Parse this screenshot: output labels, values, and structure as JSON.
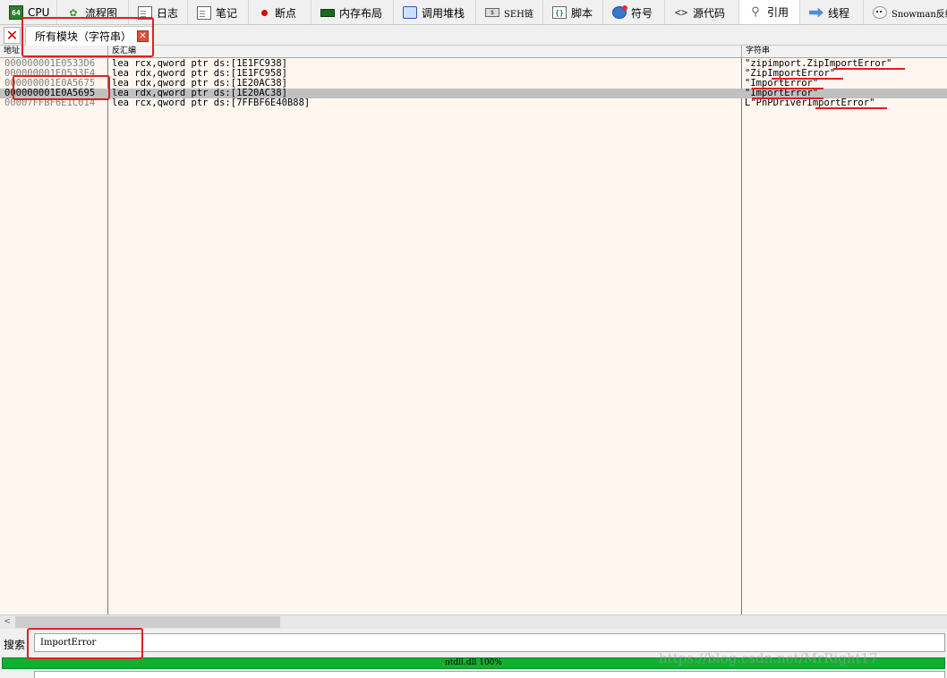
{
  "tabs": [
    {
      "label": "CPU",
      "icon": "cpu-icon"
    },
    {
      "label": "流程图",
      "icon": "graph-icon"
    },
    {
      "label": "日志",
      "icon": "log-icon"
    },
    {
      "label": "笔记",
      "icon": "notes-icon"
    },
    {
      "label": "断点",
      "icon": "breakpoint-icon"
    },
    {
      "label": "内存布局",
      "icon": "memory-map-icon"
    },
    {
      "label": "调用堆栈",
      "icon": "call-stack-icon"
    },
    {
      "label": "SEH链",
      "icon": "seh-icon"
    },
    {
      "label": "脚本",
      "icon": "script-icon"
    },
    {
      "label": "符号",
      "icon": "symbols-icon"
    },
    {
      "label": "源代码",
      "icon": "source-icon"
    },
    {
      "label": "引用",
      "icon": "references-icon",
      "active": true
    },
    {
      "label": "线程",
      "icon": "threads-icon"
    },
    {
      "label": "Snowman反编译",
      "icon": "snowman-icon"
    }
  ],
  "subtab": {
    "label": "所有模块（字符串）"
  },
  "table": {
    "columns": [
      "地址",
      "反汇编",
      "字符串"
    ],
    "rows": [
      {
        "address": "000000001E0533D6",
        "disasm": "lea rcx,qword ptr ds:[1E1FC938]",
        "string": "\"zipimport.ZipImportError\""
      },
      {
        "address": "000000001E0533F4",
        "disasm": "lea rdx,qword ptr ds:[1E1FC958]",
        "string": "\"ZipImportError\""
      },
      {
        "address": "000000001E0A5675",
        "disasm": "lea rdx,qword ptr ds:[1E20AC38]",
        "string": "\"ImportError\""
      },
      {
        "address": "000000001E0A5695",
        "disasm": "lea rdx,qword ptr ds:[1E20AC38]",
        "string": "\"ImportError\"",
        "selected": true
      },
      {
        "address": "00007FFBF6E1C014",
        "disasm": "lea rcx,qword ptr ds:[7FFBF6E40B88]",
        "string": "L\"PnPDriverImportError\""
      }
    ]
  },
  "search": {
    "label": "搜索",
    "value": "ImportError"
  },
  "status": {
    "progress_text": "ntdll.dll 100%",
    "progress": 1.0
  },
  "watermark": "https://blog.csdn.net/MrRight17",
  "colors": {
    "accent_annotation": "#e02020",
    "progress": "#10b030",
    "table_bg": "#fff6f0",
    "selected_row": "#c0c0c0"
  }
}
